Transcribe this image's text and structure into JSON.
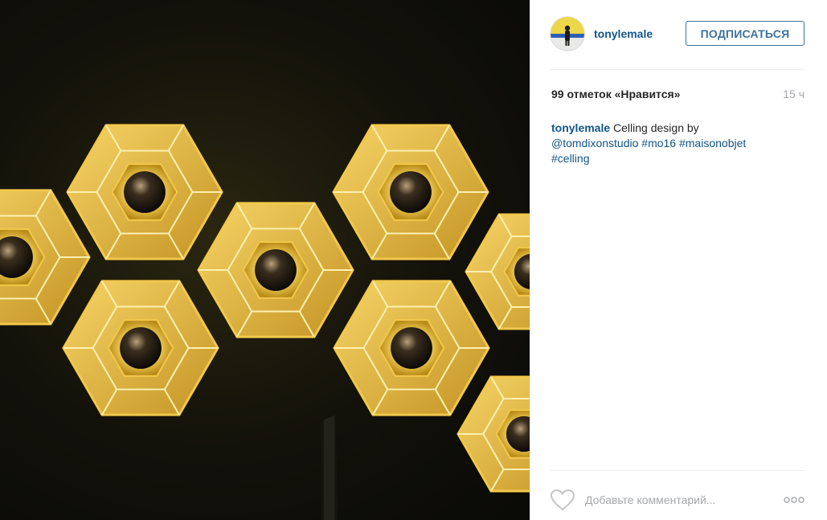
{
  "post": {
    "image": {
      "subject": "hexagonal-gold-ceiling-lamps",
      "colors": {
        "frame": "#f2c84b",
        "glow": "#ffe48a",
        "background": "#0d0d07"
      }
    },
    "author": {
      "username": "tonylemale",
      "follow_label": "ПОДПИСАТЬСЯ"
    },
    "likes_label": "99 отметок «Нравится»",
    "time_label": "15 ч",
    "caption": {
      "username": "tonylemale",
      "text": "Celling design by",
      "mention": "@tomdixonstudio",
      "hashtags": [
        "#mo16",
        "#maisonobjet",
        "#celling"
      ]
    },
    "comment": {
      "placeholder": "Добавьте комментарий..."
    },
    "icons": {
      "like": "heart-outline-icon",
      "more": "more-options-icon"
    },
    "colors": {
      "link": "#125688",
      "button": "#3f729b",
      "muted": "#a5a7aa",
      "text": "#262626"
    }
  }
}
